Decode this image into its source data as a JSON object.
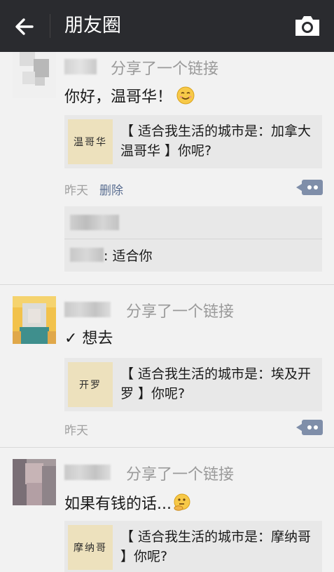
{
  "header": {
    "title": "朋友圈"
  },
  "posts": [
    {
      "share_label": "分享了一个链接",
      "text": "你好，温哥华！",
      "link": {
        "thumb_text": "温哥华",
        "title": "【 适合我生活的城市是：加拿大温哥华 】你呢?"
      },
      "time": "昨天",
      "delete_label": "删除",
      "comments": [
        {
          "text": ""
        },
        {
          "text": ": 适合你"
        }
      ]
    },
    {
      "share_label": "分享了一个链接",
      "text": "✓ 想去",
      "link": {
        "thumb_text": "开罗",
        "title": "【 适合我生活的城市是：埃及开罗 】你呢?"
      },
      "time": "昨天"
    },
    {
      "share_label": "分享了一个链接",
      "text": "如果有钱的话...",
      "link": {
        "thumb_text": "摩纳哥",
        "title": "【 适合我生活的城市是：摩纳哥 】你呢?"
      }
    }
  ],
  "colors": {
    "topbar": "#2a2b2f",
    "background": "#f2f2f2",
    "link_blue": "#5a6e91",
    "card_bg": "#e8e8e8"
  }
}
